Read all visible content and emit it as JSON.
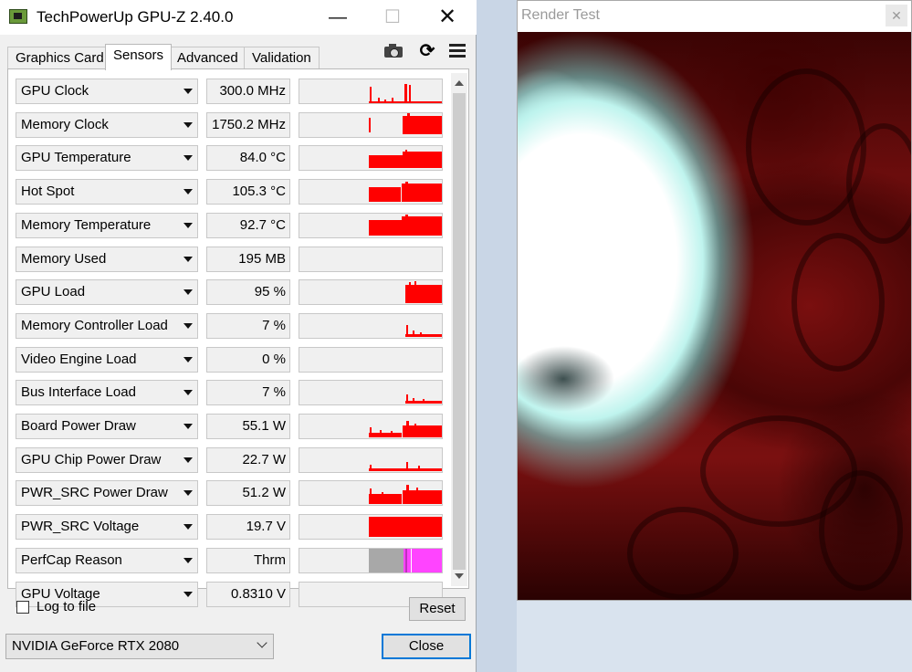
{
  "gpuz": {
    "title": "TechPowerUp GPU-Z 2.40.0",
    "window_buttons": {
      "minimize": "—",
      "maximize": "☐",
      "close": "✕"
    },
    "tabs": [
      "Graphics Card",
      "Sensors",
      "Advanced",
      "Validation"
    ],
    "active_tab": "Sensors",
    "toolbar_icons": [
      "camera-icon",
      "refresh-icon",
      "menu-icon"
    ],
    "refresh_glyph": "⟳",
    "sensors": [
      {
        "name": "GPU Clock",
        "value": "300.0 MHz"
      },
      {
        "name": "Memory Clock",
        "value": "1750.2 MHz"
      },
      {
        "name": "GPU Temperature",
        "value": "84.0 °C"
      },
      {
        "name": "Hot Spot",
        "value": "105.3 °C"
      },
      {
        "name": "Memory Temperature",
        "value": "92.7 °C"
      },
      {
        "name": "Memory Used",
        "value": "195 MB"
      },
      {
        "name": "GPU Load",
        "value": "95 %"
      },
      {
        "name": "Memory Controller Load",
        "value": "7 %"
      },
      {
        "name": "Video Engine Load",
        "value": "0 %"
      },
      {
        "name": "Bus Interface Load",
        "value": "7 %"
      },
      {
        "name": "Board Power Draw",
        "value": "55.1 W"
      },
      {
        "name": "GPU Chip Power Draw",
        "value": "22.7 W"
      },
      {
        "name": "PWR_SRC Power Draw",
        "value": "51.2 W"
      },
      {
        "name": "PWR_SRC Voltage",
        "value": "19.7 V"
      },
      {
        "name": "PerfCap Reason",
        "value": "Thrm"
      },
      {
        "name": "GPU Voltage",
        "value": "0.8310 V"
      }
    ],
    "graph_color": "#ff0000",
    "perfcap_colors": {
      "idle": "#a8a8a8",
      "thermal": "#ff44ff"
    },
    "log_to_file_label": "Log to file",
    "log_to_file_checked": false,
    "reset_label": "Reset",
    "gpu_selected": "NVIDIA GeForce RTX 2080",
    "close_label": "Close"
  },
  "render_test": {
    "title": "Render Test",
    "close_glyph": "✕"
  }
}
